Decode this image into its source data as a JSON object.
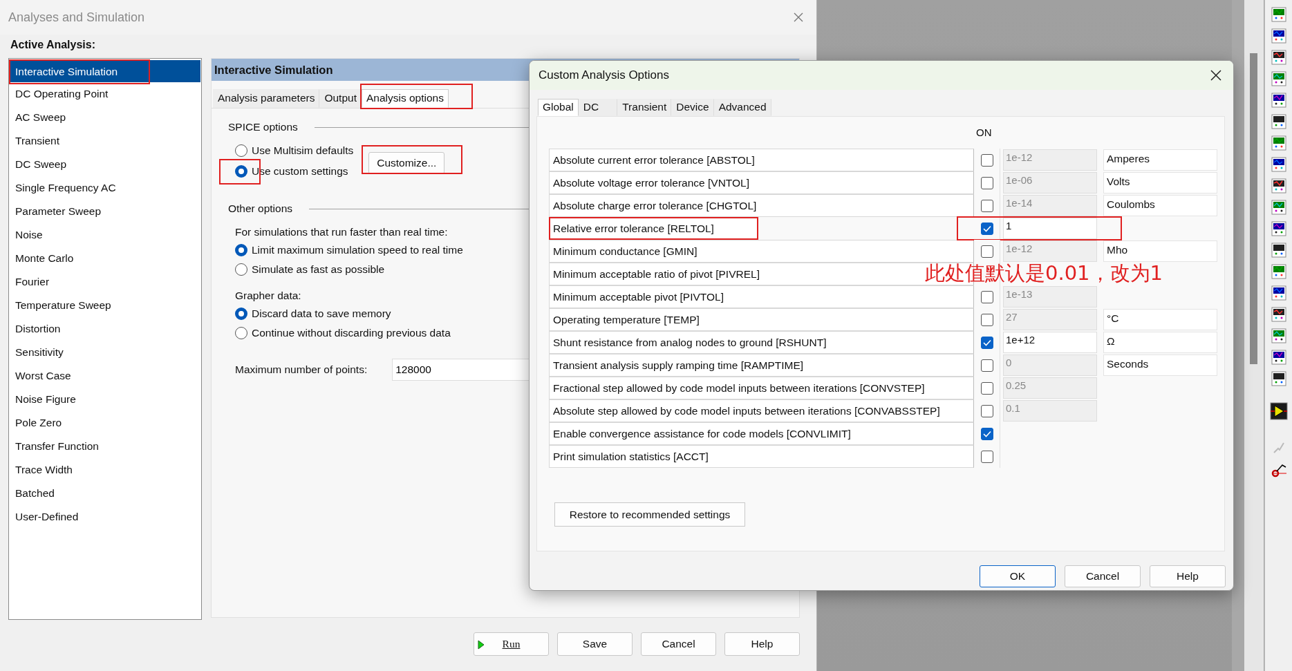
{
  "main_window": {
    "title": "Analyses and Simulation",
    "active_analysis_label": "Active Analysis:",
    "analyses": [
      {
        "label": "Interactive Simulation",
        "selected": true,
        "highlighted": true
      },
      {
        "label": "DC Operating Point",
        "selected": false,
        "highlighted": false
      },
      {
        "label": "AC Sweep",
        "selected": false,
        "highlighted": false
      },
      {
        "label": "Transient",
        "selected": false,
        "highlighted": false
      },
      {
        "label": "DC Sweep",
        "selected": false,
        "highlighted": false
      },
      {
        "label": "Single Frequency AC",
        "selected": false,
        "highlighted": false
      },
      {
        "label": "Parameter Sweep",
        "selected": false,
        "highlighted": false
      },
      {
        "label": "Noise",
        "selected": false,
        "highlighted": false
      },
      {
        "label": "Monte Carlo",
        "selected": false,
        "highlighted": false
      },
      {
        "label": "Fourier",
        "selected": false,
        "highlighted": false
      },
      {
        "label": "Temperature Sweep",
        "selected": false,
        "highlighted": false
      },
      {
        "label": "Distortion",
        "selected": false,
        "highlighted": false
      },
      {
        "label": "Sensitivity",
        "selected": false,
        "highlighted": false
      },
      {
        "label": "Worst Case",
        "selected": false,
        "highlighted": false
      },
      {
        "label": "Noise Figure",
        "selected": false,
        "highlighted": false
      },
      {
        "label": "Pole Zero",
        "selected": false,
        "highlighted": false
      },
      {
        "label": "Transfer Function",
        "selected": false,
        "highlighted": false
      },
      {
        "label": "Trace Width",
        "selected": false,
        "highlighted": false
      },
      {
        "label": "Batched",
        "selected": false,
        "highlighted": false
      },
      {
        "label": "User-Defined",
        "selected": false,
        "highlighted": false
      }
    ],
    "panel_title": "Interactive Simulation",
    "tabs": [
      {
        "label": "Analysis parameters",
        "selected": false,
        "highlighted": false
      },
      {
        "label": "Output",
        "selected": false,
        "highlighted": false
      },
      {
        "label": "Analysis options",
        "selected": true,
        "highlighted": true
      }
    ],
    "spice_heading": "SPICE options",
    "spice_options": [
      {
        "label": "Use Multisim defaults",
        "selected": false,
        "highlighted": false
      },
      {
        "label": "Use custom settings",
        "selected": true,
        "highlighted": true
      }
    ],
    "customize_button": {
      "label": "Customize...",
      "highlighted": true
    },
    "other_heading": "Other options",
    "speed_prompt": "For simulations that run faster than real time:",
    "speed_options": [
      {
        "label": "Limit maximum simulation speed to real time",
        "selected": true
      },
      {
        "label": "Simulate as fast as possible",
        "selected": false
      }
    ],
    "grapher_prompt": "Grapher data:",
    "grapher_options": [
      {
        "label": "Discard data to save memory",
        "selected": true
      },
      {
        "label": "Continue without discarding previous data",
        "selected": false
      }
    ],
    "max_points_label": "Maximum number of points:",
    "max_points_value": "128000",
    "buttons": [
      {
        "label": "Run",
        "kind": "run"
      },
      {
        "label": "Save",
        "kind": "plain"
      },
      {
        "label": "Cancel",
        "kind": "plain"
      },
      {
        "label": "Help",
        "kind": "plain"
      }
    ]
  },
  "custom_dialog": {
    "title": "Custom Analysis Options",
    "tabs": [
      {
        "label": "Global",
        "selected": true
      },
      {
        "label": "DC",
        "selected": false
      },
      {
        "label": "Transient",
        "selected": false
      },
      {
        "label": "Device",
        "selected": false
      },
      {
        "label": "Advanced",
        "selected": false
      }
    ],
    "on_header": "ON",
    "rows": [
      {
        "label": "Absolute current error tolerance [ABSTOL]",
        "on": false,
        "value": "1e-12",
        "unit": "Amperes",
        "highlighted": false
      },
      {
        "label": "Absolute voltage error tolerance [VNTOL]",
        "on": false,
        "value": "1e-06",
        "unit": "Volts",
        "highlighted": false
      },
      {
        "label": "Absolute charge error tolerance [CHGTOL]",
        "on": false,
        "value": "1e-14",
        "unit": "Coulombs",
        "highlighted": false
      },
      {
        "label": "Relative error tolerance [RELTOL]",
        "on": true,
        "value": "1",
        "highlighted": true
      },
      {
        "label": "Minimum conductance [GMIN]",
        "on": false,
        "value": "1e-12",
        "unit": "Mho",
        "highlighted": false
      },
      {
        "label": "Minimum acceptable ratio of pivot [PIVREL]",
        "highlighted": false
      },
      {
        "label": "Minimum acceptable pivot [PIVTOL]",
        "on": false,
        "value": "1e-13",
        "highlighted": false
      },
      {
        "label": "Operating temperature [TEMP]",
        "on": false,
        "value": "27",
        "unit": "°C",
        "highlighted": false
      },
      {
        "label": "Shunt resistance from analog nodes to ground [RSHUNT]",
        "on": true,
        "value": "1e+12",
        "unit": "Ω",
        "highlighted": false
      },
      {
        "label": "Transient analysis supply ramping time [RAMPTIME]",
        "on": false,
        "value": "0",
        "unit": "Seconds",
        "highlighted": false
      },
      {
        "label": "Fractional step allowed by code model inputs between iterations [CONVSTEP]",
        "on": false,
        "value": "0.25",
        "highlighted": false
      },
      {
        "label": "Absolute step allowed by code model inputs between iterations [CONVABSSTEP]",
        "on": false,
        "value": "0.1",
        "highlighted": false
      },
      {
        "label": "Enable convergence assistance for code models [CONVLIMIT]",
        "on": true,
        "highlighted": false
      },
      {
        "label": "Print simulation statistics [ACCT]",
        "on": false,
        "highlighted": false
      }
    ],
    "restore_button": "Restore to recommended settings",
    "buttons": [
      {
        "label": "OK",
        "default": true
      },
      {
        "label": "Cancel",
        "default": false
      },
      {
        "label": "Help",
        "default": false
      }
    ]
  },
  "annotation": "此处值默认是0.01，改为1"
}
